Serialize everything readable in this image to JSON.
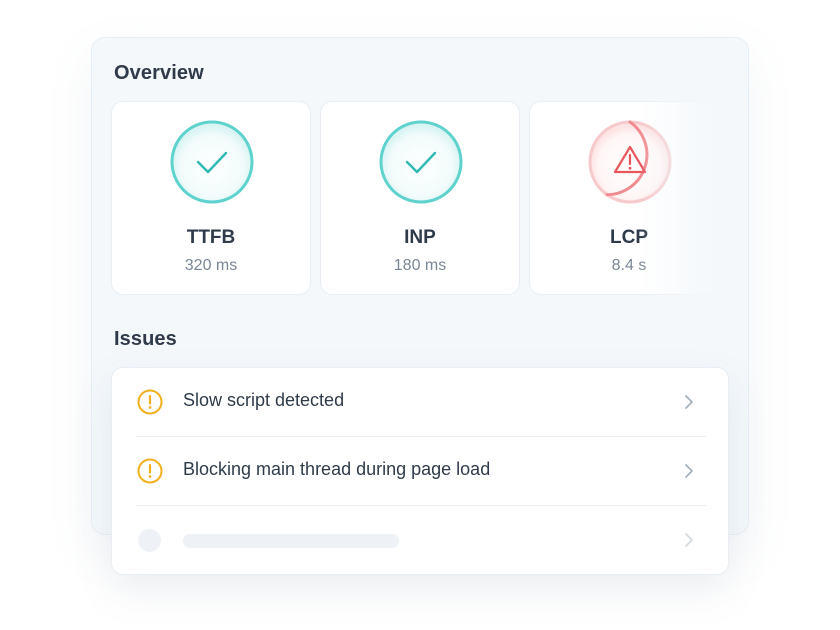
{
  "overview": {
    "title": "Overview",
    "metrics": [
      {
        "name": "TTFB",
        "value": "320 ms",
        "status": "good",
        "icon": "check-icon"
      },
      {
        "name": "INP",
        "value": "180 ms",
        "status": "good",
        "icon": "check-icon"
      },
      {
        "name": "LCP",
        "value": "8.4 s",
        "status": "poor",
        "icon": "warning-triangle-icon"
      }
    ]
  },
  "issues": {
    "title": "Issues",
    "items": [
      {
        "text": "Slow script detected",
        "icon": "exclamation-circle-icon"
      },
      {
        "text": "Blocking main thread during page load",
        "icon": "exclamation-circle-icon"
      }
    ],
    "placeholder_rows": 1
  },
  "colors": {
    "good": "#3cc7c3",
    "poor": "#ee6b70",
    "warning": "#f2b01e",
    "text": "#2f3b4b",
    "muted": "#7a8797"
  }
}
